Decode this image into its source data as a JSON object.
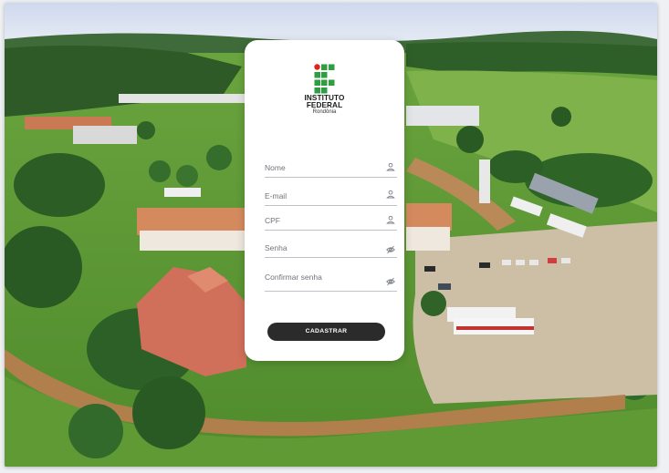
{
  "brand": {
    "title_line1": "INSTITUTO",
    "title_line2": "FEDERAL",
    "subtitle": "Rondônia",
    "logo_colors": {
      "red": "#e1251b",
      "green": "#2f9e41"
    }
  },
  "form": {
    "fields": [
      {
        "label": "Nome",
        "icon": "user-icon"
      },
      {
        "label": "E-mail",
        "icon": "user-icon"
      },
      {
        "label": "CPF",
        "icon": "user-icon"
      },
      {
        "label": "Senha",
        "icon": "eye-slash-icon"
      },
      {
        "label": "Confirmar senha",
        "icon": "eye-slash-icon"
      }
    ],
    "submit_label": "CADASTRAR"
  },
  "background": {
    "description_icon": "campus-aerial-photo"
  }
}
